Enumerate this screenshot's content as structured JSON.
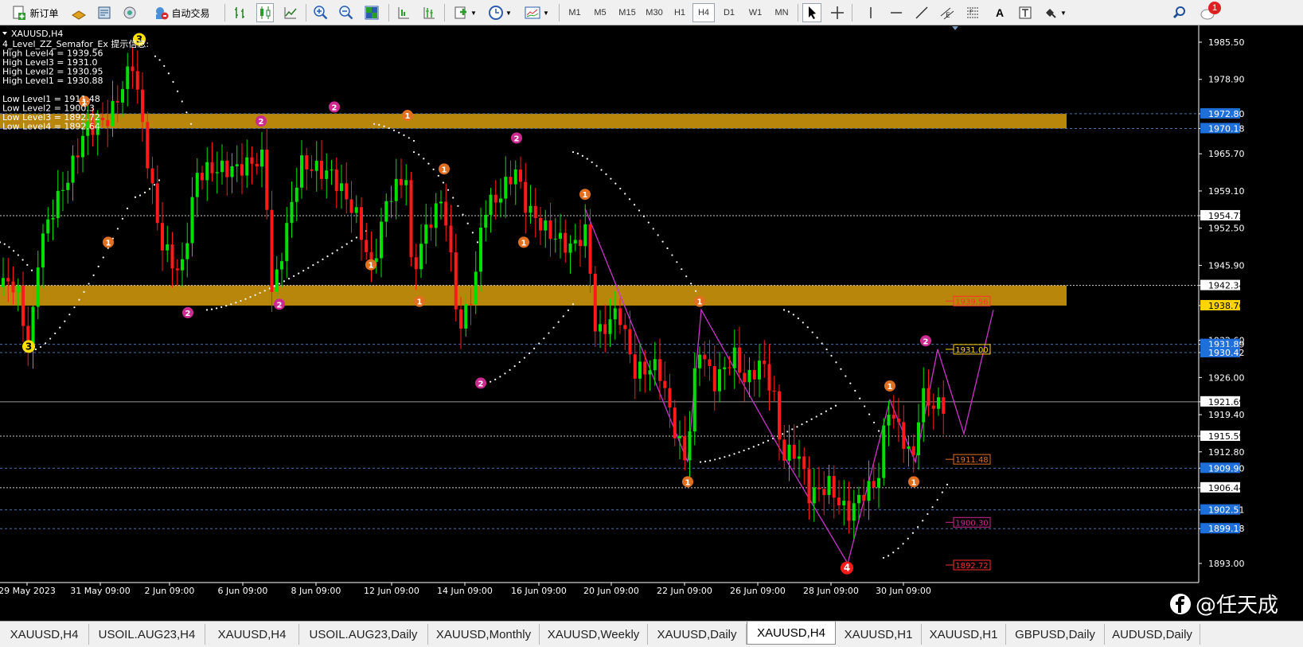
{
  "toolbar": {
    "new_order": "新订单",
    "auto_trading": "自动交易",
    "timeframes": [
      "M1",
      "M5",
      "M15",
      "M30",
      "H1",
      "H4",
      "D1",
      "W1",
      "MN"
    ],
    "active_timeframe": "H4",
    "notification_count": "1"
  },
  "chart": {
    "symbol_label": "XAUUSD,H4",
    "indicator_lines": [
      "4_Level_ZZ_Semafor_Ex 提示信息:",
      "High Level4 = 1939.56",
      "High Level3 = 1931.0",
      "High Level2 = 1930.95",
      "High Level1 = 1930.88",
      "",
      "Low Level1 = 1911.48",
      "Low Level2 = 1900.3",
      "Low Level3 = 1892.72",
      "Low Level4 = 1892.64"
    ],
    "price_axis": [
      "1985.50",
      "1978.90",
      "1972.80",
      "1970.18",
      "1965.70",
      "1959.10",
      "1954.72",
      "1952.50",
      "1945.90",
      "1942.34",
      "1938.76",
      "1932.60",
      "1931.89",
      "1930.42",
      "1926.00",
      "1921.69",
      "1919.40",
      "1915.59",
      "1912.80",
      "1909.90",
      "1906.44",
      "1902.51",
      "1899.18",
      "1893.00"
    ],
    "time_axis": [
      "29 May 2023",
      "31 May 09:00",
      "2 Jun 09:00",
      "6 Jun 09:00",
      "8 Jun 09:00",
      "12 Jun 09:00",
      "14 Jun 09:00",
      "16 Jun 09:00",
      "20 Jun 09:00",
      "22 Jun 09:00",
      "26 Jun 09:00",
      "28 Jun 09:00",
      "30 Jun 09:00"
    ],
    "level_tags": [
      "1939.56",
      "1931.00",
      "1911.48",
      "1900.30",
      "1892.72"
    ],
    "semafor_marks": [
      "1",
      "2",
      "3",
      "4"
    ]
  },
  "watermark": "@任天成",
  "colors": {
    "background": "#000000",
    "bull": "#00e000",
    "bear": "#ff1a1a",
    "zone": "#b8860b",
    "zigzag": "#cc33cc",
    "grid_dash": "#4a6fa5",
    "axis_text": "#ffffff",
    "highlight_blue": "#1e6fd9",
    "highlight_yellow": "#ffd400"
  },
  "tabs": [
    "XAUUSD,H4",
    "USOIL.AUG23,H4",
    "XAUUSD,H4",
    "USOIL.AUG23,Daily",
    "XAUUSD,Monthly",
    "XAUUSD,Weekly",
    "XAUUSD,Daily",
    "XAUUSD,H4",
    "XAUUSD,H1",
    "XAUUSD,H1",
    "GBPUSD,Daily",
    "AUDUSD,Daily"
  ],
  "active_tab": 7
}
